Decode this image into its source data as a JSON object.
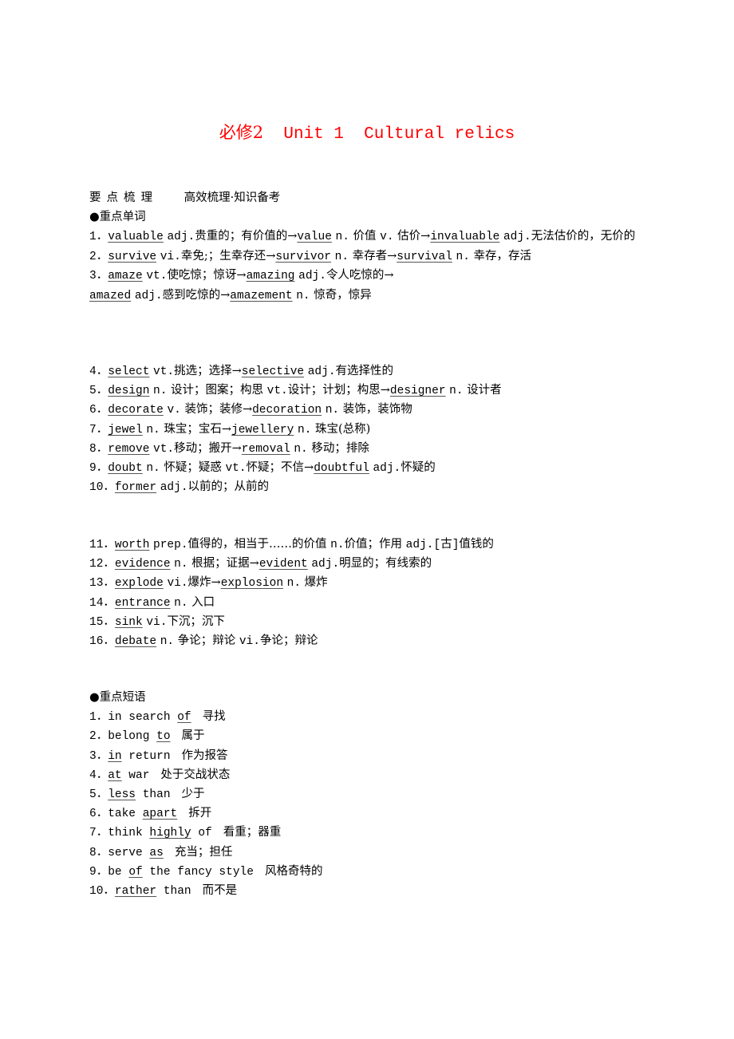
{
  "title": {
    "cn": "必修2",
    "en": "Unit 1  Cultural relics"
  },
  "header": {
    "label": "要点梳理",
    "subtitle": "高效梳理·知识备考"
  },
  "words_heading": "●重点单词",
  "words_group1": [
    {
      "num": "1．",
      "word": "valuable",
      "rest": [
        " adj.贵重的；有价值的→",
        {
          "u": "value"
        },
        " n. 价值 v. 估价→",
        {
          "u": "invaluable"
        },
        " adj.无法估价的，无价的"
      ]
    },
    {
      "num": "2．",
      "word": "survive",
      "rest": [
        " vi.幸免;；生幸存还→",
        {
          "u": "survivor"
        },
        " n. 幸存者→",
        {
          "u": "survival"
        },
        " n. 幸存，存活"
      ]
    },
    {
      "num": "3．",
      "word": "amaze",
      "rest": [
        " vt.使吃惊；惊讶→",
        {
          "u": "amazing"
        },
        " adj.令人吃惊的→"
      ]
    },
    {
      "num": "",
      "word": "amazed",
      "rest": [
        " adj.感到吃惊的→",
        {
          "u": "amazement"
        },
        " n. 惊奇，惊异"
      ]
    }
  ],
  "words_group2": [
    {
      "num": "4．",
      "word": "select",
      "rest": [
        " vt.挑选；选择→",
        {
          "u": "selective"
        },
        " adj.有选择性的"
      ]
    },
    {
      "num": "5．",
      "word": "design",
      "rest": [
        " n. 设计；图案；构思 vt.设计；计划；构思→",
        {
          "u": "designer"
        },
        " n. 设计者"
      ]
    },
    {
      "num": "6．",
      "word": "decorate",
      "rest": [
        " v. 装饰；装修→",
        {
          "u": "decoration"
        },
        " n. 装饰，装饰物"
      ]
    },
    {
      "num": "7．",
      "word": "jewel",
      "rest": [
        " n. 珠宝；宝石→",
        {
          "u": "jewellery"
        },
        " n. 珠宝(总称)"
      ]
    },
    {
      "num": "8．",
      "word": "remove",
      "rest": [
        " vt.移动；搬开→",
        {
          "u": "removal"
        },
        " n. 移动；排除"
      ]
    },
    {
      "num": "9．",
      "word": "doubt",
      "rest": [
        " n. 怀疑；疑惑 vt.怀疑；不信→",
        {
          "u": "doubtful"
        },
        " adj.怀疑的"
      ]
    },
    {
      "num": "10．",
      "word": "former",
      "rest": [
        " adj.以前的；从前的"
      ]
    }
  ],
  "words_group3": [
    {
      "num": "11．",
      "word": "worth",
      "rest": [
        " prep.值得的，相当于……的价值 n.价值；作用 adj.[古]值钱的"
      ]
    },
    {
      "num": "12．",
      "word": "evidence",
      "rest": [
        " n. 根据；证据→",
        {
          "u": "evident"
        },
        " adj.明显的；有线索的"
      ]
    },
    {
      "num": "13．",
      "word": "explode",
      "rest": [
        " vi.爆炸→",
        {
          "u": "explosion"
        },
        " n. 爆炸"
      ]
    },
    {
      "num": "14．",
      "word": "entrance",
      "rest": [
        " n. 入口"
      ]
    },
    {
      "num": "15．",
      "word": "sink",
      "rest": [
        " vi.下沉；沉下"
      ]
    },
    {
      "num": "16．",
      "word": "debate",
      "rest": [
        " n. 争论；辩论 vi.争论；辩论"
      ]
    }
  ],
  "phrases_heading": "●重点短语",
  "phrases": [
    {
      "num": "1．",
      "parts": [
        "in search ",
        {
          "u": "of"
        }
      ],
      "meaning": "寻找"
    },
    {
      "num": "2．",
      "parts": [
        "belong ",
        {
          "u": "to"
        }
      ],
      "meaning": "属于"
    },
    {
      "num": "3．",
      "parts": [
        {
          "u": "in"
        },
        " return"
      ],
      "meaning": "作为报答"
    },
    {
      "num": "4．",
      "parts": [
        {
          "u": "at"
        },
        " war"
      ],
      "meaning": "处于交战状态"
    },
    {
      "num": "5．",
      "parts": [
        {
          "u": "less"
        },
        " than"
      ],
      "meaning": "少于"
    },
    {
      "num": "6．",
      "parts": [
        "take ",
        {
          "u": "apart"
        }
      ],
      "meaning": "拆开"
    },
    {
      "num": "7．",
      "parts": [
        "think ",
        {
          "u": "highly"
        },
        " of"
      ],
      "meaning": "看重；器重"
    },
    {
      "num": "8．",
      "parts": [
        "serve ",
        {
          "u": "as"
        }
      ],
      "meaning": "充当；担任"
    },
    {
      "num": "9．",
      "parts": [
        "be ",
        {
          "u": "of"
        },
        " the fancy style"
      ],
      "meaning": "风格奇特的"
    },
    {
      "num": "10．",
      "parts": [
        {
          "u": "rather"
        },
        " than"
      ],
      "meaning": "而不是"
    }
  ]
}
